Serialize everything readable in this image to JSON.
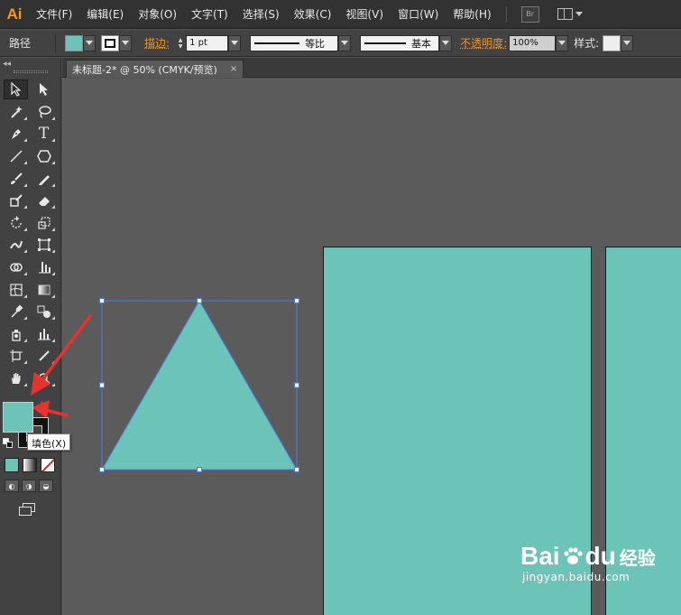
{
  "app": {
    "logo": "Ai"
  },
  "menu": {
    "items": [
      "文件(F)",
      "编辑(E)",
      "对象(O)",
      "文字(T)",
      "选择(S)",
      "效果(C)",
      "视图(V)",
      "窗口(W)",
      "帮助(H)"
    ],
    "bridge_label": "Br"
  },
  "control_bar": {
    "object_type": "路径",
    "fill_color": "#6cc4b8",
    "stroke_label": "描边:",
    "stroke_weight": "1 pt",
    "stroke_profile": "等比",
    "brush": "基本",
    "opacity_label": "不透明度:",
    "opacity_value": "100%",
    "style_label": "样式:"
  },
  "document": {
    "tab_title": "未标题-2* @ 50% (CMYK/预览)",
    "close_glyph": "×"
  },
  "tools": {
    "rows": [
      [
        "selection-tool",
        "direct-selection-tool"
      ],
      [
        "magic-wand-tool",
        "lasso-tool"
      ],
      [
        "pen-tool",
        "type-tool"
      ],
      [
        "line-segment-tool",
        "polygon-tool"
      ],
      [
        "paintbrush-tool",
        "pencil-tool"
      ],
      [
        "blob-brush-tool",
        "eraser-tool"
      ],
      [
        "rotate-tool",
        "scale-tool"
      ],
      [
        "warp-tool",
        "free-transform-tool"
      ],
      [
        "shape-builder-tool",
        "perspective-grid-tool"
      ],
      [
        "mesh-tool",
        "gradient-tool"
      ],
      [
        "eyedropper-tool",
        "blend-tool"
      ],
      [
        "symbol-sprayer-tool",
        "column-graph-tool"
      ],
      [
        "artboard-tool",
        "slice-tool"
      ],
      [
        "hand-tool",
        "zoom-tool"
      ]
    ],
    "type_glyph": "T",
    "fill_color": "#6cc4b8",
    "stroke_color": "#111111",
    "tooltip": "填色(X)"
  },
  "shape": {
    "type": "triangle",
    "fill": "#6cc4b8",
    "selection_color": "#4a7fe0"
  },
  "annotation": {
    "arrow_color": "#e8322e"
  },
  "watermark": {
    "brand": "Bai",
    "brand_suffix": "du",
    "cn": "经验",
    "url": "jingyan.baidu.com"
  }
}
